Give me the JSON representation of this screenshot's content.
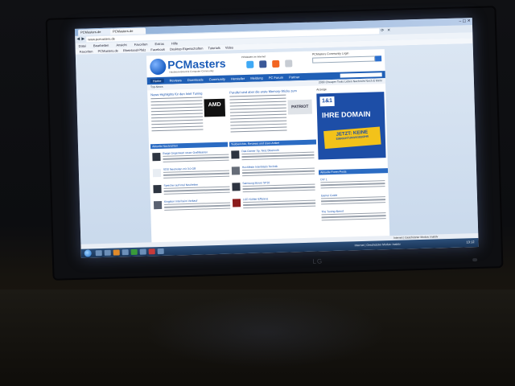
{
  "browser": {
    "tabs": [
      {
        "label": "PCMasters.de"
      },
      {
        "label": "PCMasters.de"
      }
    ],
    "window_controls": "– ▢ ✕",
    "address": "www.pcmasters.de",
    "menu": [
      "Datei",
      "Bearbeiten",
      "Ansicht",
      "Favoriten",
      "Extras",
      "Hilfe"
    ],
    "bookmarks": [
      "Favoriten",
      "PCMasters.de",
      "Rheinland-Pfalz",
      "Facebook",
      "Desktop-Eigenschaften",
      "Tutorials",
      "Video"
    ],
    "status": "Internet | Geschützter Modus: Inaktiv"
  },
  "site": {
    "logo": "PCMasters",
    "tagline": "Hardware-Board & Computer-Community",
    "header_center": "PCMasters im Internet",
    "login_label": "PCMasters Community Login",
    "nav": [
      {
        "label": "Home",
        "active": true
      },
      {
        "label": "Reviews"
      },
      {
        "label": "Downloads"
      },
      {
        "label": "Community"
      },
      {
        "label": "Hersteller"
      },
      {
        "label": "Meldung"
      },
      {
        "label": "PC Forum"
      },
      {
        "label": "Partner"
      }
    ],
    "breadcrumb": "Top-News",
    "subnav_right": "2000 Cheaper   Tools Leben   Nachricht   Noch & Mehr",
    "headline_left": "News-Highlights für den Intel Tuning",
    "headline_right": "Parallel sind aber die erste Memory-Sticks zum",
    "amd_label": "AMD",
    "amd_caption": "Aktuell AMD",
    "patriot_label": "PATRIOT",
    "section_left": "Aktuelle Nachrichten",
    "section_right": "Testberichte, Reviews und User-Artikel",
    "section_side": "Aktuelle Foren-Posts",
    "left_list": [
      "Ewige Gegenwart neuer Grafikkarten",
      "SDD Neuheiten mit 3.0 GB",
      "Speicher auf Intel Neuheiten",
      "Kingston Intel beim Verkauf"
    ],
    "right_list": [
      "Das Gamer Sp. Netz Bluetooth",
      "Hochfeste Intel Basis Technik",
      "Samsung Mover SP10",
      "LCD Kühler-Effizienz"
    ],
    "side_list": [
      "DIY 1",
      "Gamer Guide",
      "The Tuning Abend"
    ]
  },
  "ad": {
    "label": "Anzeige",
    "brand": "1&1",
    "headline": "IHRE DOMAIN",
    "cta_line1": "JETZT: KEINE",
    "cta_line2": "EINRICHTUNGSGEBÜHR"
  },
  "taskbar": {
    "tray": "Internet | Geschützter Modus: Inaktiv",
    "clock": "13:12"
  },
  "monitor": {
    "brand": "LG"
  }
}
